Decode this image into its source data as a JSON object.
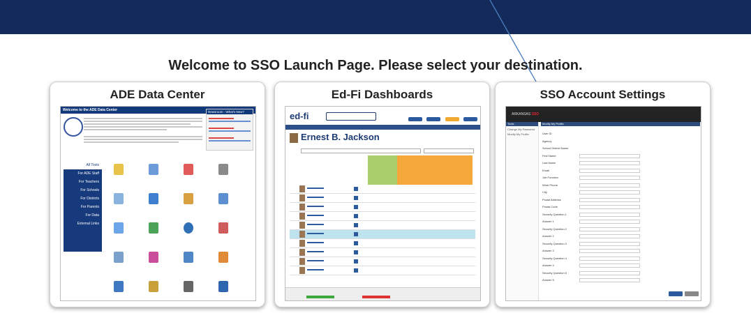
{
  "page": {
    "welcome": "Welcome to SSO Launch Page. Please select your destination."
  },
  "cards": {
    "ade": {
      "title": "ADE Data Center",
      "header": "Welcome to the ADE Data Center",
      "news_title": "Newsroom - What's New?",
      "nav": [
        "All Tools",
        "For ADE Staff",
        "For Teachers",
        "For Schools",
        "For Districts",
        "For Parents",
        "For Data",
        "External Links"
      ]
    },
    "edfi": {
      "title": "Ed-Fi Dashboards",
      "logo": "ed-fi",
      "student_name": "Ernest B. Jackson"
    },
    "sso": {
      "title": "SSO Account Settings",
      "brand_a": "ARKANSAS",
      "brand_b": "SSO",
      "panel_title": "Modify My Profile",
      "left_title": "Tools",
      "left_items": [
        "Change My Password",
        "Modify My Profile"
      ],
      "fields": [
        "User ID",
        "Agency",
        "School District Name",
        "First Name",
        "Last Name",
        "Email",
        "Job Function",
        "Work Phone",
        "City",
        "Postal Address",
        "Postal Code",
        "Security Question 1",
        "Answer 1",
        "Security Question 2",
        "Answer 2",
        "Security Question 3",
        "Answer 3",
        "Security Question 4",
        "Answer 4",
        "Security Question 5",
        "Answer 5"
      ],
      "submit": "Submit",
      "cancel": "Cancel"
    }
  },
  "colors": {
    "topbar": "#142a5a",
    "arrow": "#4a7ec0"
  }
}
